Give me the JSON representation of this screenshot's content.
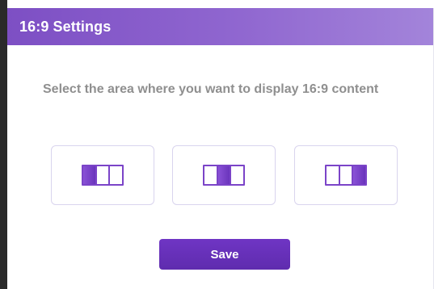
{
  "dialog": {
    "title": "16:9 Settings",
    "prompt": "Select the area where you want to display 16:9 content",
    "options": [
      {
        "icon": "split-left-highlight-icon",
        "selected_pane": "left"
      },
      {
        "icon": "split-center-highlight-icon",
        "selected_pane": "center"
      },
      {
        "icon": "split-right-highlight-icon",
        "selected_pane": "right"
      }
    ],
    "save_label": "Save"
  },
  "colors": {
    "header_start": "#7d4fc4",
    "header_end": "#a384da",
    "accent": "#6f35c4",
    "prompt_text": "#8f8f8f",
    "option_border": "#d9d4ee"
  }
}
